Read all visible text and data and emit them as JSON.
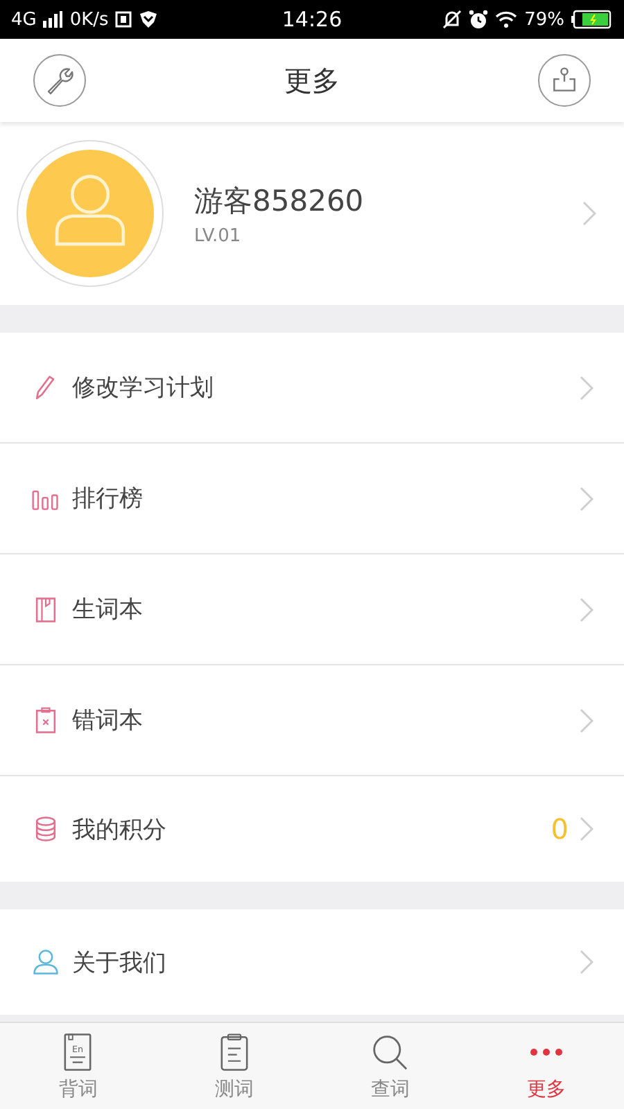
{
  "status_bar": {
    "network": "4G",
    "speed": "0K/s",
    "time": "14:26",
    "battery": "79%"
  },
  "header": {
    "title": "更多"
  },
  "profile": {
    "name": "游客858260",
    "level_text": "LV.01"
  },
  "menu_groups": [
    {
      "items": [
        {
          "kind": "pencil",
          "label": "修改学习计划"
        },
        {
          "kind": "ranking",
          "label": "排行榜"
        },
        {
          "kind": "notebook",
          "label": "生词本"
        },
        {
          "kind": "mistakes",
          "label": "错词本"
        },
        {
          "kind": "points",
          "label": "我的积分",
          "value": "0"
        }
      ]
    },
    {
      "items": [
        {
          "kind": "about",
          "label": "关于我们"
        }
      ]
    }
  ],
  "tabs": [
    {
      "kind": "book",
      "icon_text": "En",
      "label": "背词",
      "selected": false
    },
    {
      "kind": "test",
      "label": "测词",
      "selected": false
    },
    {
      "kind": "search",
      "label": "查词",
      "selected": false
    },
    {
      "kind": "more",
      "label": "更多",
      "selected": true
    }
  ]
}
